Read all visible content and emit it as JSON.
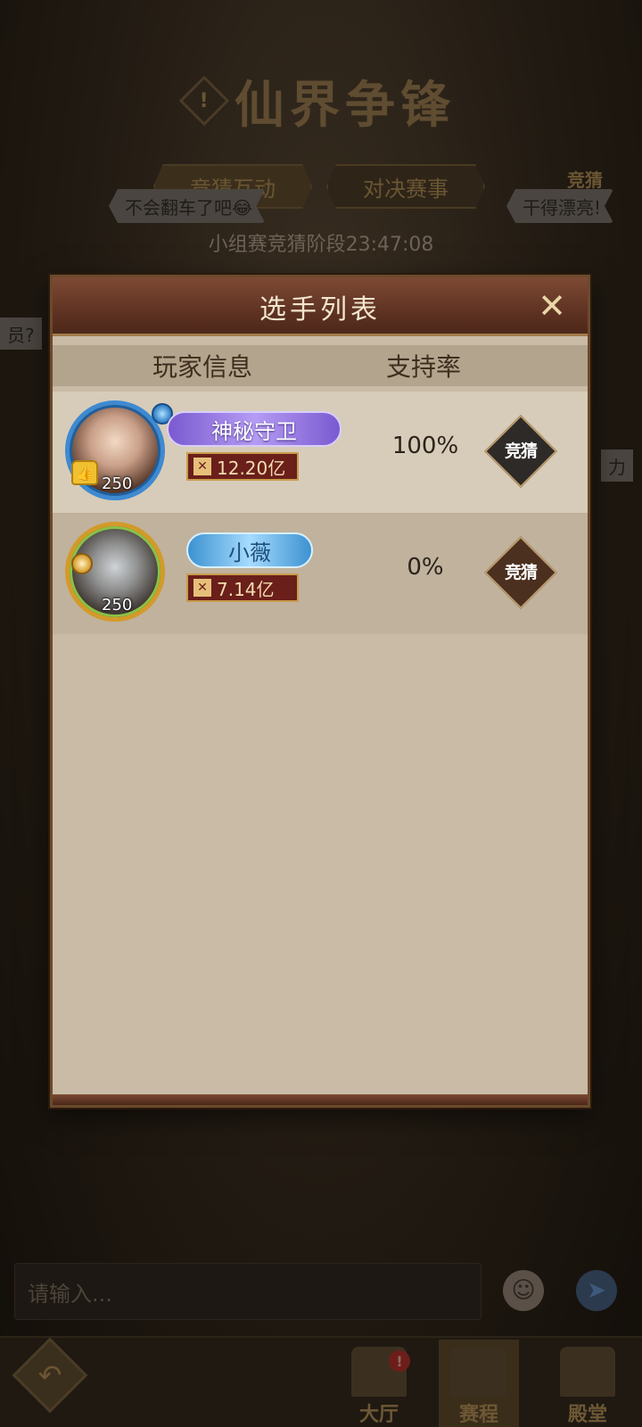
{
  "background": {
    "title": "仙界争锋",
    "tabs": [
      "竞猜互动",
      "对决赛事"
    ],
    "guess_label": "竞猜",
    "stage_info": "小组赛竞猜阶段23:47:08",
    "danmaku": [
      "不会翻车了吧😂",
      "干得漂亮!",
      "员?",
      "力"
    ],
    "chat_placeholder": "请输入...",
    "nav": [
      {
        "label": "大厅",
        "badge": "!"
      },
      {
        "label": "赛程"
      },
      {
        "label": "殿堂"
      }
    ]
  },
  "modal": {
    "title": "选手列表",
    "close": "✕",
    "columns": {
      "player_info": "玩家信息",
      "support_rate": "支持率"
    },
    "players": [
      {
        "name": "神秘守卫",
        "level": "250",
        "power": "12.20亿",
        "support_rate": "100%",
        "guess_label": "竞猜"
      },
      {
        "name": "小薇",
        "level": "250",
        "power": "7.14亿",
        "support_rate": "0%",
        "guess_label": "竞猜"
      }
    ]
  },
  "colors": {
    "modal_bg": "#c9bba6",
    "header_bg": "#5e3222",
    "power_bg": "#6a1f1a"
  }
}
